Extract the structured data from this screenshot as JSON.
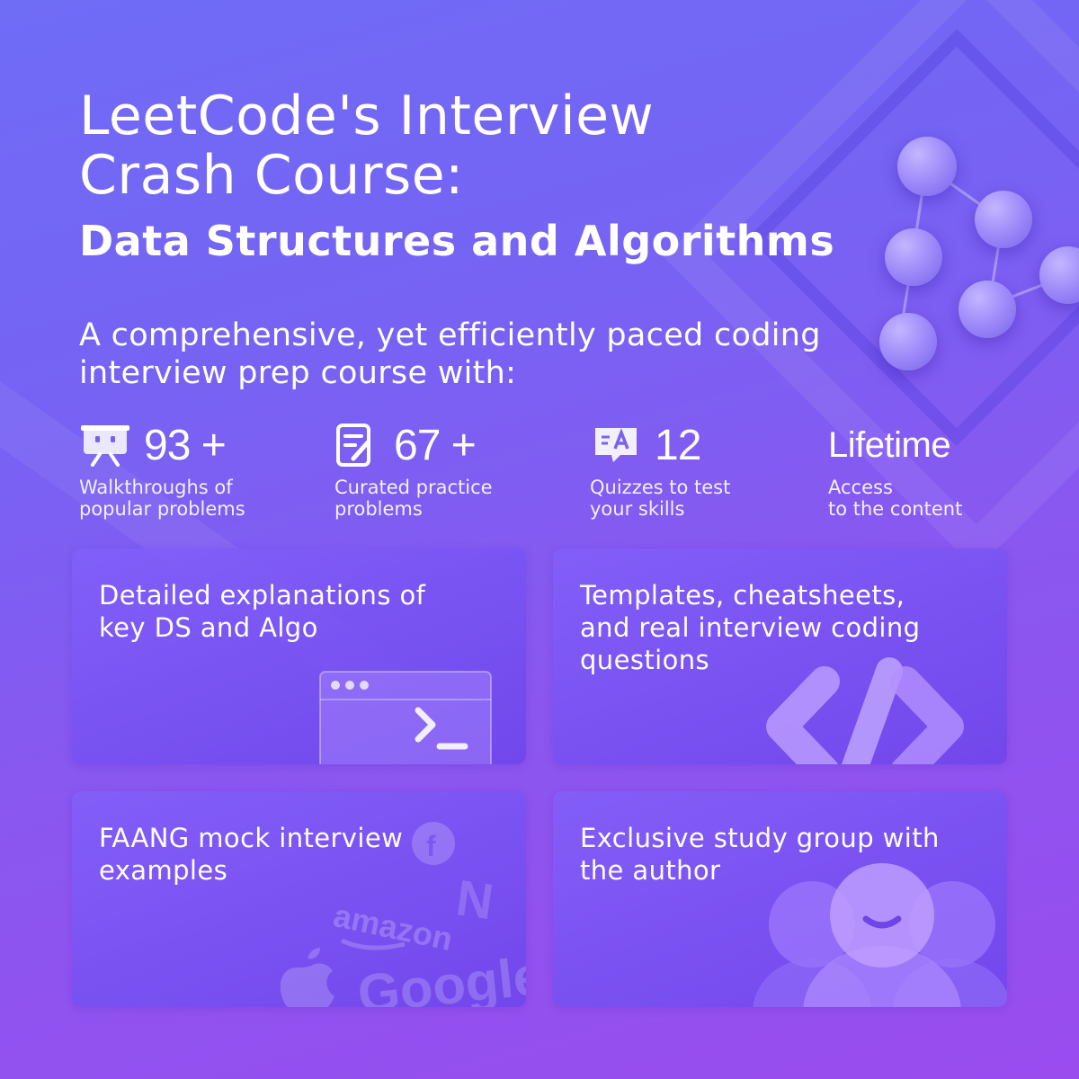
{
  "header": {
    "title_line1": "LeetCode's Interview",
    "title_line2": "Crash Course:",
    "subtitle": "Data Structures and Algorithms",
    "intro_line1": "A comprehensive, yet efficiently paced coding",
    "intro_line2": "interview prep course with:"
  },
  "stats": [
    {
      "icon": "presentation-icon",
      "number": "93 +",
      "desc_line1": "Walkthroughs of",
      "desc_line2": "popular problems"
    },
    {
      "icon": "document-edit-icon",
      "number": "67 +",
      "desc_line1": "Curated practice",
      "desc_line2": "problems"
    },
    {
      "icon": "quiz-chat-icon",
      "number": "12",
      "desc_line1": "Quizzes to test",
      "desc_line2": "your skills"
    },
    {
      "icon": "",
      "number": "Lifetime",
      "desc_line1": "Access",
      "desc_line2": "to the content"
    }
  ],
  "cards": [
    {
      "line1": "Detailed explanations of",
      "line2": "key DS and Algo",
      "line3": "",
      "art": "terminal-window-icon"
    },
    {
      "line1": "Templates, cheatsheets,",
      "line2": "and real interview coding",
      "line3": "questions",
      "art": "code-brackets-icon"
    },
    {
      "line1": "FAANG mock interview",
      "line2": "examples",
      "line3": "",
      "art": "company-logos",
      "logos": {
        "amazon": "amazon",
        "google": "Google",
        "netflix": "N",
        "facebook": "f"
      }
    },
    {
      "line1": "Exclusive study group with",
      "line2": "the author",
      "line3": "",
      "art": "people-group-icon"
    }
  ],
  "colors": {
    "bg_top": "#6f6cf6",
    "bg_bottom": "#9a4cef",
    "card": "#7a55f0",
    "text": "#ffffff"
  }
}
